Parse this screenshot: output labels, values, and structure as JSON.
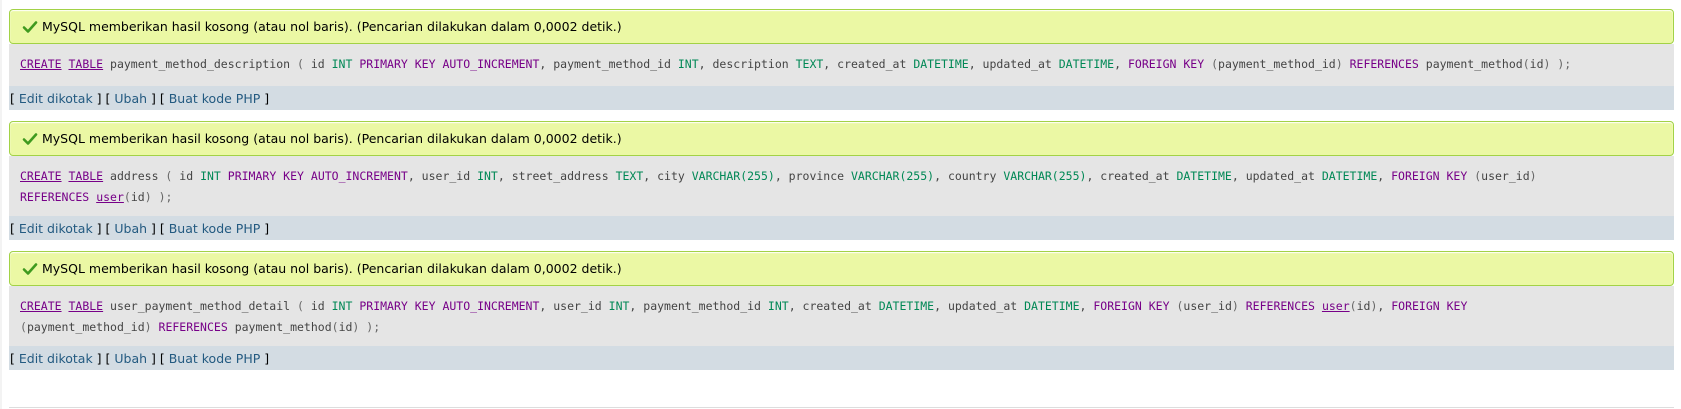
{
  "results": [
    {
      "message": "MySQL memberikan hasil kosong (atau nol baris). (Pencarian dilakukan dalam 0,0002 detik.)",
      "sql_lines": [
        [
          {
            "t": "CREATE",
            "c": "kw-u"
          },
          {
            "t": " ",
            "c": "ident"
          },
          {
            "t": "TABLE",
            "c": "kw-u"
          },
          {
            "t": " payment_method_description ",
            "c": "ident"
          },
          {
            "t": "(",
            "c": "punct"
          },
          {
            "t": " id ",
            "c": "ident"
          },
          {
            "t": "INT",
            "c": "ty"
          },
          {
            "t": " ",
            "c": "ident"
          },
          {
            "t": "PRIMARY KEY",
            "c": "kw"
          },
          {
            "t": " ",
            "c": "ident"
          },
          {
            "t": "AUTO_INCREMENT",
            "c": "kw"
          },
          {
            "t": ", payment_method_id ",
            "c": "ident"
          },
          {
            "t": "INT",
            "c": "ty"
          },
          {
            "t": ", description ",
            "c": "ident"
          },
          {
            "t": "TEXT",
            "c": "ty"
          },
          {
            "t": ", created_at ",
            "c": "ident"
          },
          {
            "t": "DATETIME",
            "c": "ty"
          },
          {
            "t": ", updated_at ",
            "c": "ident"
          },
          {
            "t": "DATETIME",
            "c": "ty"
          },
          {
            "t": ", ",
            "c": "ident"
          },
          {
            "t": "FOREIGN KEY",
            "c": "kw"
          },
          {
            "t": " ",
            "c": "ident"
          },
          {
            "t": "(",
            "c": "punct"
          },
          {
            "t": "payment_method_id",
            "c": "ident"
          },
          {
            "t": ")",
            "c": "punct"
          },
          {
            "t": " ",
            "c": "ident"
          },
          {
            "t": "REFERENCES",
            "c": "kw"
          },
          {
            "t": " payment_method",
            "c": "ident"
          },
          {
            "t": "(",
            "c": "punct"
          },
          {
            "t": "id",
            "c": "ident"
          },
          {
            "t": ")",
            "c": "punct"
          },
          {
            "t": " ",
            "c": "ident"
          },
          {
            "t": ");",
            "c": "punct"
          }
        ]
      ],
      "tools": {
        "edit_inline": "Edit dikotak",
        "edit": "Ubah",
        "php": "Buat kode PHP"
      }
    },
    {
      "message": "MySQL memberikan hasil kosong (atau nol baris). (Pencarian dilakukan dalam 0,0002 detik.)",
      "sql_lines": [
        [
          {
            "t": "CREATE",
            "c": "kw-u"
          },
          {
            "t": " ",
            "c": "ident"
          },
          {
            "t": "TABLE",
            "c": "kw-u"
          },
          {
            "t": " address ",
            "c": "ident"
          },
          {
            "t": "(",
            "c": "punct"
          },
          {
            "t": " id ",
            "c": "ident"
          },
          {
            "t": "INT",
            "c": "ty"
          },
          {
            "t": " ",
            "c": "ident"
          },
          {
            "t": "PRIMARY KEY",
            "c": "kw"
          },
          {
            "t": " ",
            "c": "ident"
          },
          {
            "t": "AUTO_INCREMENT",
            "c": "kw"
          },
          {
            "t": ", user_id ",
            "c": "ident"
          },
          {
            "t": "INT",
            "c": "ty"
          },
          {
            "t": ", street_address ",
            "c": "ident"
          },
          {
            "t": "TEXT",
            "c": "ty"
          },
          {
            "t": ", city ",
            "c": "ident"
          },
          {
            "t": "VARCHAR(255)",
            "c": "ty"
          },
          {
            "t": ", province ",
            "c": "ident"
          },
          {
            "t": "VARCHAR(255)",
            "c": "ty"
          },
          {
            "t": ", country ",
            "c": "ident"
          },
          {
            "t": "VARCHAR(255)",
            "c": "ty"
          },
          {
            "t": ", created_at ",
            "c": "ident"
          },
          {
            "t": "DATETIME",
            "c": "ty"
          },
          {
            "t": ", updated_at ",
            "c": "ident"
          },
          {
            "t": "DATETIME",
            "c": "ty"
          },
          {
            "t": ", ",
            "c": "ident"
          },
          {
            "t": "FOREIGN KEY",
            "c": "kw"
          },
          {
            "t": " ",
            "c": "ident"
          },
          {
            "t": "(",
            "c": "punct"
          },
          {
            "t": "user_id",
            "c": "ident"
          },
          {
            "t": ")",
            "c": "punct"
          }
        ],
        [
          {
            "t": "REFERENCES",
            "c": "kw"
          },
          {
            "t": " ",
            "c": "ident"
          },
          {
            "t": "user",
            "c": "fn-u"
          },
          {
            "t": "(",
            "c": "punct"
          },
          {
            "t": "id",
            "c": "ident"
          },
          {
            "t": ")",
            "c": "punct"
          },
          {
            "t": " ",
            "c": "ident"
          },
          {
            "t": ");",
            "c": "punct"
          }
        ]
      ],
      "tools": {
        "edit_inline": "Edit dikotak",
        "edit": "Ubah",
        "php": "Buat kode PHP"
      }
    },
    {
      "message": "MySQL memberikan hasil kosong (atau nol baris). (Pencarian dilakukan dalam 0,0002 detik.)",
      "sql_lines": [
        [
          {
            "t": "CREATE",
            "c": "kw-u"
          },
          {
            "t": " ",
            "c": "ident"
          },
          {
            "t": "TABLE",
            "c": "kw-u"
          },
          {
            "t": " user_payment_method_detail ",
            "c": "ident"
          },
          {
            "t": "(",
            "c": "punct"
          },
          {
            "t": " id ",
            "c": "ident"
          },
          {
            "t": "INT",
            "c": "ty"
          },
          {
            "t": " ",
            "c": "ident"
          },
          {
            "t": "PRIMARY KEY",
            "c": "kw"
          },
          {
            "t": " ",
            "c": "ident"
          },
          {
            "t": "AUTO_INCREMENT",
            "c": "kw"
          },
          {
            "t": ", user_id ",
            "c": "ident"
          },
          {
            "t": "INT",
            "c": "ty"
          },
          {
            "t": ", payment_method_id ",
            "c": "ident"
          },
          {
            "t": "INT",
            "c": "ty"
          },
          {
            "t": ", created_at ",
            "c": "ident"
          },
          {
            "t": "DATETIME",
            "c": "ty"
          },
          {
            "t": ", updated_at ",
            "c": "ident"
          },
          {
            "t": "DATETIME",
            "c": "ty"
          },
          {
            "t": ", ",
            "c": "ident"
          },
          {
            "t": "FOREIGN KEY",
            "c": "kw"
          },
          {
            "t": " ",
            "c": "ident"
          },
          {
            "t": "(",
            "c": "punct"
          },
          {
            "t": "user_id",
            "c": "ident"
          },
          {
            "t": ")",
            "c": "punct"
          },
          {
            "t": " ",
            "c": "ident"
          },
          {
            "t": "REFERENCES",
            "c": "kw"
          },
          {
            "t": " ",
            "c": "ident"
          },
          {
            "t": "user",
            "c": "fn-u"
          },
          {
            "t": "(",
            "c": "punct"
          },
          {
            "t": "id",
            "c": "ident"
          },
          {
            "t": ")",
            "c": "punct"
          },
          {
            "t": ", ",
            "c": "ident"
          },
          {
            "t": "FOREIGN KEY",
            "c": "kw"
          }
        ],
        [
          {
            "t": "(",
            "c": "punct"
          },
          {
            "t": "payment_method_id",
            "c": "ident"
          },
          {
            "t": ")",
            "c": "punct"
          },
          {
            "t": " ",
            "c": "ident"
          },
          {
            "t": "REFERENCES",
            "c": "kw"
          },
          {
            "t": " payment_method",
            "c": "ident"
          },
          {
            "t": "(",
            "c": "punct"
          },
          {
            "t": "id",
            "c": "ident"
          },
          {
            "t": ")",
            "c": "punct"
          },
          {
            "t": " ",
            "c": "ident"
          },
          {
            "t": ");",
            "c": "punct"
          }
        ]
      ],
      "tools": {
        "edit_inline": "Edit dikotak",
        "edit": "Ubah",
        "php": "Buat kode PHP"
      }
    }
  ],
  "icons": {
    "success": "check-icon"
  },
  "colors": {
    "success_bg": "#ebf8a4",
    "success_border": "#a2d246",
    "sql_bg": "#e5e5e5",
    "tools_bg": "#d3dce3",
    "link": "#235a81"
  }
}
